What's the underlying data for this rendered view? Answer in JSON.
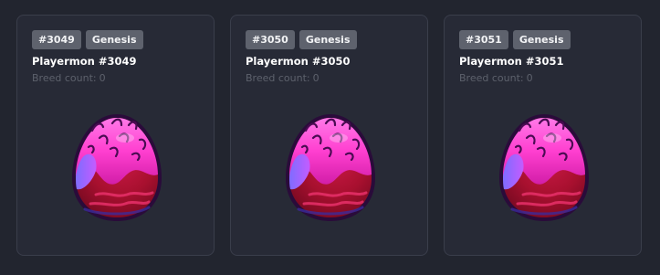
{
  "cards": [
    {
      "id_badge": "#3049",
      "type_badge": "Genesis",
      "name": "Playermon #3049",
      "breed_label": "Breed count:",
      "breed_count": "0"
    },
    {
      "id_badge": "#3050",
      "type_badge": "Genesis",
      "name": "Playermon #3050",
      "breed_label": "Breed count:",
      "breed_count": "0"
    },
    {
      "id_badge": "#3051",
      "type_badge": "Genesis",
      "name": "Playermon #3051",
      "breed_label": "Breed count:",
      "breed_count": "0"
    }
  ],
  "colors": {
    "background": "#22252f",
    "card_background": "#272a36",
    "card_border": "#3a3e4b",
    "badge_background": "#5e626d",
    "egg_top": "#ff4fd8",
    "egg_side": "#8a6bff",
    "egg_body": "#c01c3b"
  }
}
